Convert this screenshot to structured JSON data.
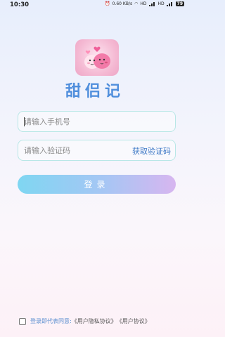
{
  "status_bar": {
    "time": "10:30",
    "network_speed": "0.60 KB/s",
    "signal1": "HD",
    "signal2": "HD",
    "battery": "79"
  },
  "app": {
    "title": "甜侣记"
  },
  "form": {
    "phone_placeholder": "请输入手机号",
    "code_placeholder": "请输入验证码",
    "get_code_label": "获取验证码",
    "login_label": "登录"
  },
  "agreement": {
    "prefix": "登录即代表同意:",
    "privacy_link": "《用户隐私协议》",
    "user_link": "《用户协议》"
  }
}
